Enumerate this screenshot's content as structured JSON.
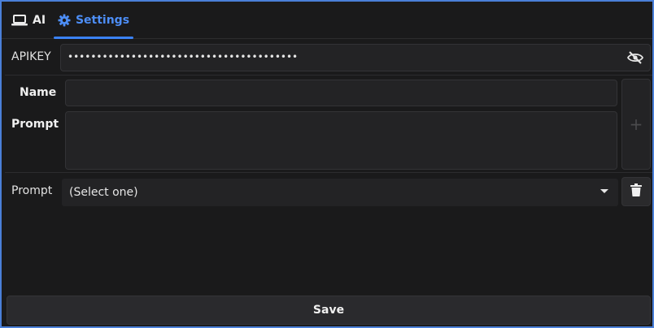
{
  "tabs": {
    "ai_label": "AI",
    "settings_label": "Settings"
  },
  "apikey": {
    "label": "APIKEY",
    "masked_value": "••••••••••••••••••••••••••••••••••••••••",
    "visibility_icon": "eye-off-icon"
  },
  "form": {
    "name_label": "Name",
    "name_value": "",
    "prompt_label": "Prompt",
    "prompt_value": "",
    "add_icon": "+"
  },
  "prompt_select": {
    "label": "Prompt",
    "selected": "(Select one)"
  },
  "save_label": "Save",
  "colors": {
    "accent": "#3b82f6",
    "background": "#1a1a1b",
    "field": "#232325"
  }
}
